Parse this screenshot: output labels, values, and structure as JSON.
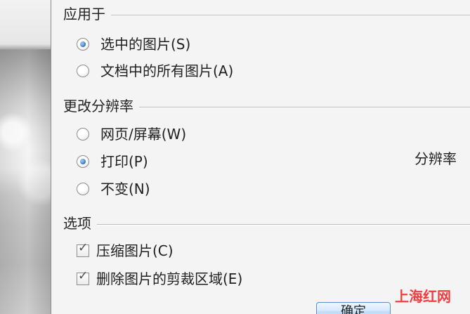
{
  "dialog": {
    "apply_to": {
      "title": "应用于",
      "options": [
        {
          "label": "选中的图片(S)",
          "selected": true
        },
        {
          "label": "文档中的所有图片(A)",
          "selected": false
        }
      ]
    },
    "resolution": {
      "title": "更改分辨率",
      "options": [
        {
          "label": "网页/屏幕(W)",
          "selected": false
        },
        {
          "label": "打印(P)",
          "selected": true
        },
        {
          "label": "不变(N)",
          "selected": false
        }
      ],
      "side_label": "分辨率"
    },
    "options_section": {
      "title": "选项",
      "items": [
        {
          "label": "压缩图片(C)",
          "checked": true
        },
        {
          "label": "删除图片的剪裁区域(E)",
          "checked": true
        }
      ]
    },
    "buttons": {
      "ok_label": "确定"
    }
  },
  "watermark": {
    "text": "上海红网"
  },
  "colors": {
    "dialog_background": "#f4f4f4",
    "accent_blue": "#245d9d",
    "watermark_red": "#ef3d3d"
  },
  "icons": {
    "radio_selected": "radio-selected-icon",
    "radio_unselected": "radio-unselected-icon",
    "checkbox_checked": "checkbox-checked-icon"
  }
}
